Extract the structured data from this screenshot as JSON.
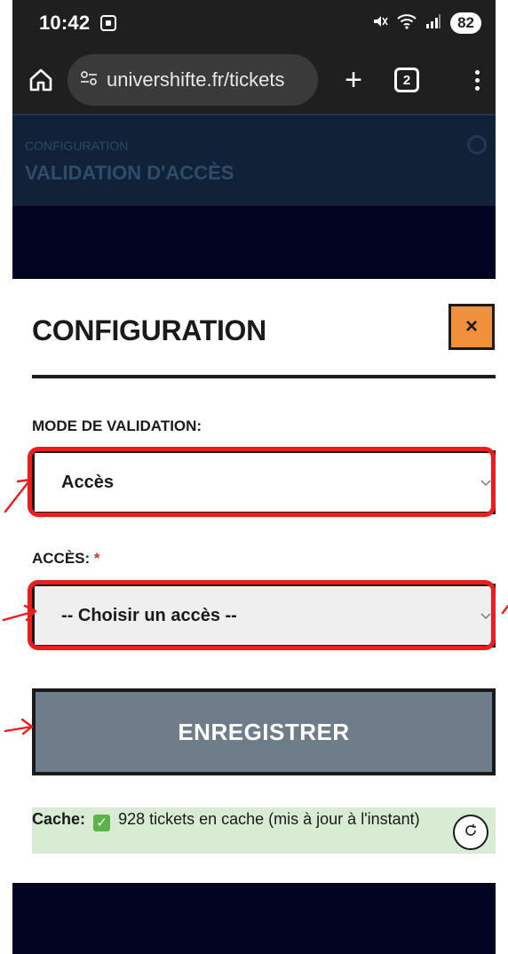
{
  "status_bar": {
    "time": "10:42",
    "battery": "82"
  },
  "browser": {
    "url": "univershifte.fr/tickets",
    "tab_count": "2"
  },
  "page_header": {
    "label": "CONFIGURATION",
    "title": "VALIDATION D'ACCÈS"
  },
  "modal": {
    "title": "CONFIGURATION",
    "close_label": "×",
    "mode_label": "MODE DE VALIDATION:",
    "mode_value": "Accès",
    "access_label": "ACCÈS:",
    "required_mark": "*",
    "access_value": "-- Choisir un accès --",
    "save_label": "ENREGISTRER",
    "cache": {
      "label": "Cache:",
      "check": "✓",
      "text": "928 tickets en cache (mis à jour à l'instant)"
    }
  },
  "colors": {
    "accent_orange": "#f0903d",
    "annotation_red": "#ee1c1c",
    "page_dark": "#020321",
    "button_grey": "#6f7d8a",
    "cache_green": "#d8ebd3"
  },
  "icons": [
    "screenshot-icon",
    "mute-icon",
    "wifi-icon",
    "signal-icon",
    "home-icon",
    "tune-icon",
    "plus-icon",
    "tabs-icon",
    "more-vert-icon",
    "close-icon",
    "chevron-down-icon",
    "check-icon",
    "refresh-icon"
  ]
}
